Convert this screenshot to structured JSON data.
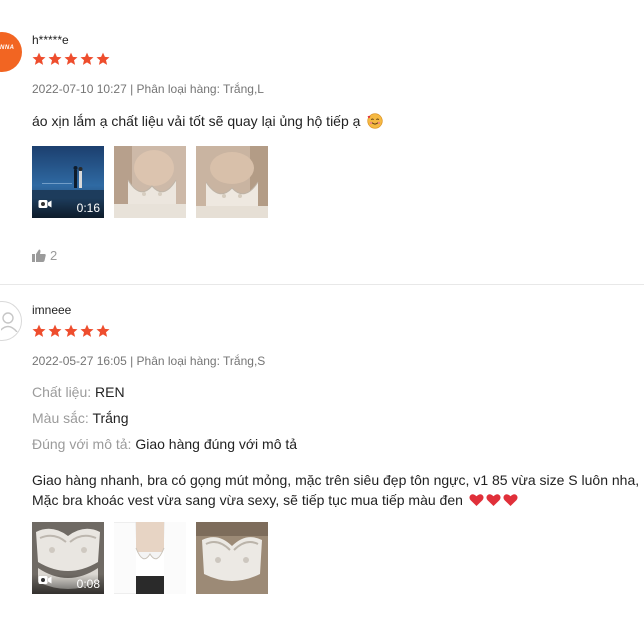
{
  "reviews": [
    {
      "username": "h*****e",
      "avatar_text": "NNA",
      "rating": 5,
      "meta": "2022-07-10 10:27 | Phân loại hàng: Trắng,L",
      "comment": "áo xịn lắm ạ chất liệu vải tốt sẽ quay lại ủng hộ tiếp ạ",
      "comment_emoji": "smiling-face-with-hearts",
      "media": [
        {
          "type": "video",
          "duration": "0:16",
          "scene": "beach-video-thumbnail"
        },
        {
          "type": "image",
          "scene": "lace-bra-photo"
        },
        {
          "type": "image",
          "scene": "lace-bra-photo"
        }
      ],
      "likes": "2"
    },
    {
      "username": "imneee",
      "rating": 5,
      "meta": "2022-05-27 16:05 | Phân loại hàng: Trắng,S",
      "attributes": [
        {
          "key": "Chất liệu:",
          "value": "REN"
        },
        {
          "key": "Màu sắc:",
          "value": "Trắng"
        },
        {
          "key": "Đúng với mô tả:",
          "value": "Giao hàng đúng với mô tả"
        }
      ],
      "comment_lines": [
        "Giao hàng nhanh, bra có gọng mút mỏng, mặc trên siêu đẹp tôn ngực, v1 85 vừa size S luôn nha,",
        "Mặc bra khoác vest vừa sang vừa sexy, sẽ tiếp tục mua tiếp màu đen"
      ],
      "comment_hearts": 3,
      "media": [
        {
          "type": "video",
          "duration": "0:08",
          "scene": "lace-bra-video-thumbnail"
        },
        {
          "type": "image",
          "scene": "bra-with-jacket-photo"
        },
        {
          "type": "image",
          "scene": "lace-bra-photo"
        }
      ]
    }
  ],
  "colors": {
    "star": "#ee4d2d",
    "heart": "#e0303a",
    "meta": "#757575",
    "attr_key": "#9b9b9b"
  }
}
